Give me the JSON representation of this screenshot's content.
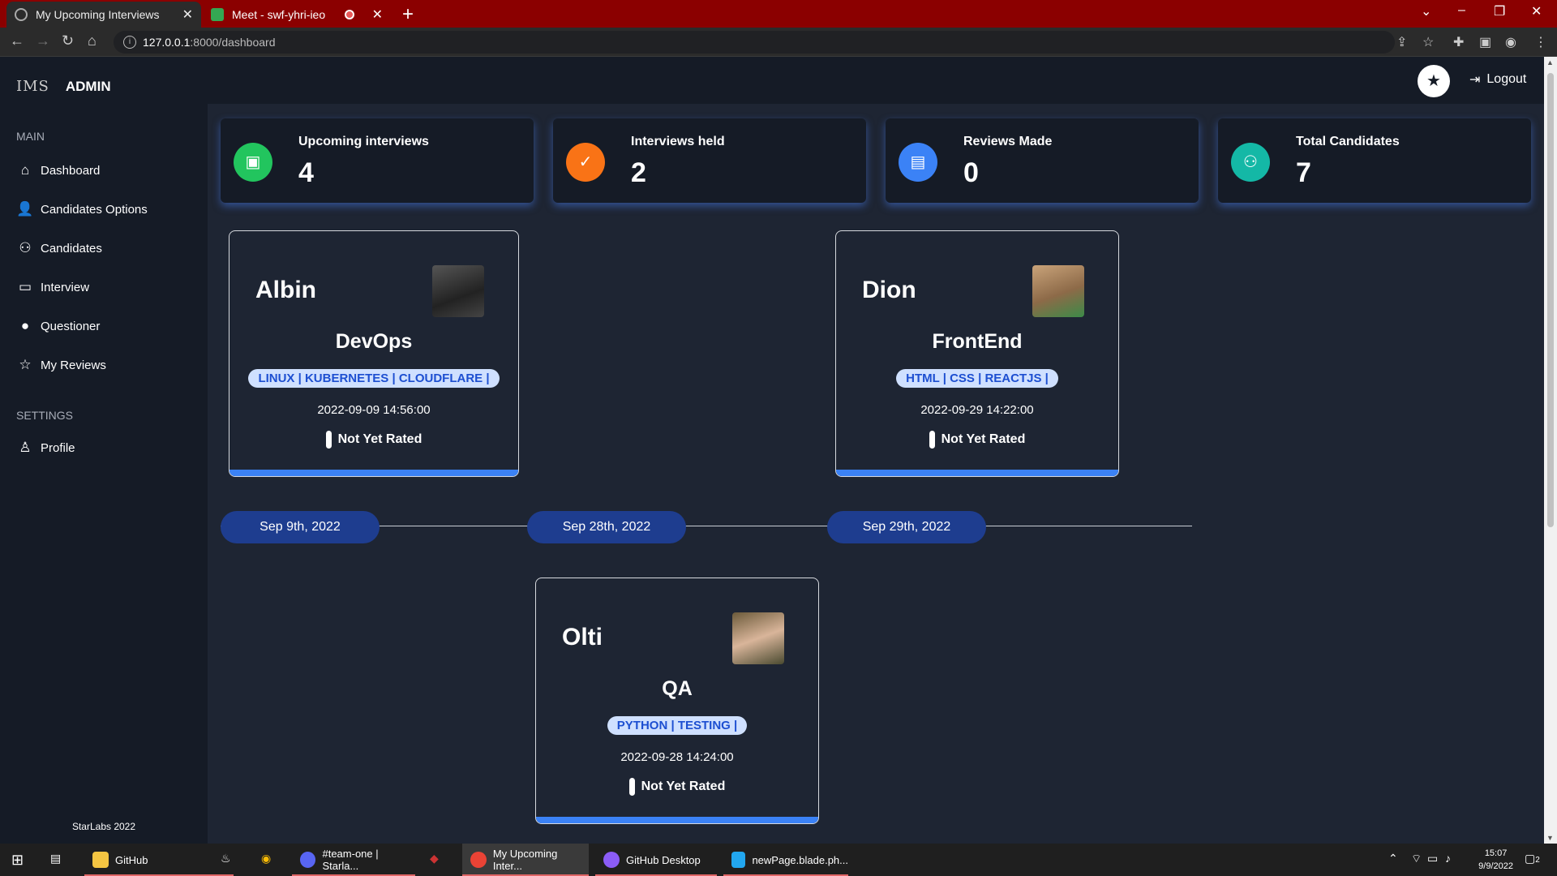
{
  "browser": {
    "tabs": [
      {
        "title": "My Upcoming Interviews",
        "active": true
      },
      {
        "title": "Meet - swf-yhri-ieo",
        "active": false
      }
    ],
    "url_host": "127.0.0.1",
    "url_rest": ":8000/dashboard"
  },
  "app": {
    "logo": "IMS",
    "brand": "ADMIN",
    "sections": {
      "main": "MAIN",
      "settings": "SETTINGS"
    },
    "nav": [
      {
        "label": "Dashboard",
        "icon": "home-icon"
      },
      {
        "label": "Candidates Options",
        "icon": "user-plus-icon"
      },
      {
        "label": "Candidates",
        "icon": "users-icon"
      },
      {
        "label": "Interview",
        "icon": "monitor-icon"
      },
      {
        "label": "Questioner",
        "icon": "user-icon"
      },
      {
        "label": "My Reviews",
        "icon": "star-icon"
      }
    ],
    "settings_nav": [
      {
        "label": "Profile",
        "icon": "user-outline-icon"
      }
    ],
    "footer": "StarLabs 2022",
    "logout": "Logout"
  },
  "stats": [
    {
      "label": "Upcoming interviews",
      "value": "4",
      "color": "#22c55e",
      "icon": "money-icon"
    },
    {
      "label": "Interviews held",
      "value": "2",
      "color": "#f97316",
      "icon": "clipboard-check-icon"
    },
    {
      "label": "Reviews Made",
      "value": "0",
      "color": "#3b82f6",
      "icon": "clipboard-icon"
    },
    {
      "label": "Total Candidates",
      "value": "7",
      "color": "#14b8a6",
      "icon": "group-icon"
    }
  ],
  "candidates": [
    {
      "name": "Albin",
      "role": "DevOps",
      "tags": "LINUX | KUBERNETES | CLOUDFLARE |",
      "date": "2022-09-09 14:56:00",
      "rating": "Not Yet Rated"
    },
    {
      "name": "Dion",
      "role": "FrontEnd",
      "tags": "HTML | CSS | REACTJS |",
      "date": "2022-09-29 14:22:00",
      "rating": "Not Yet Rated"
    },
    {
      "name": "Olti",
      "role": "QA",
      "tags": "PYTHON | TESTING |",
      "date": "2022-09-28 14:24:00",
      "rating": "Not Yet Rated"
    }
  ],
  "timeline": [
    "Sep 9th, 2022",
    "Sep 28th, 2022",
    "Sep 29th, 2022"
  ],
  "taskbar": {
    "items": [
      "GitHub",
      "#team-one | Starla...",
      "My Upcoming Inter...",
      "GitHub Desktop",
      "newPage.blade.ph..."
    ],
    "time": "15:07",
    "date": "9/9/2022",
    "notifications": "2"
  },
  "colors": {
    "accent": "#3b82f6",
    "tag_bg": "#cfe0ff",
    "tag_text": "#1d4fd1",
    "pill": "#1e3d8f"
  }
}
